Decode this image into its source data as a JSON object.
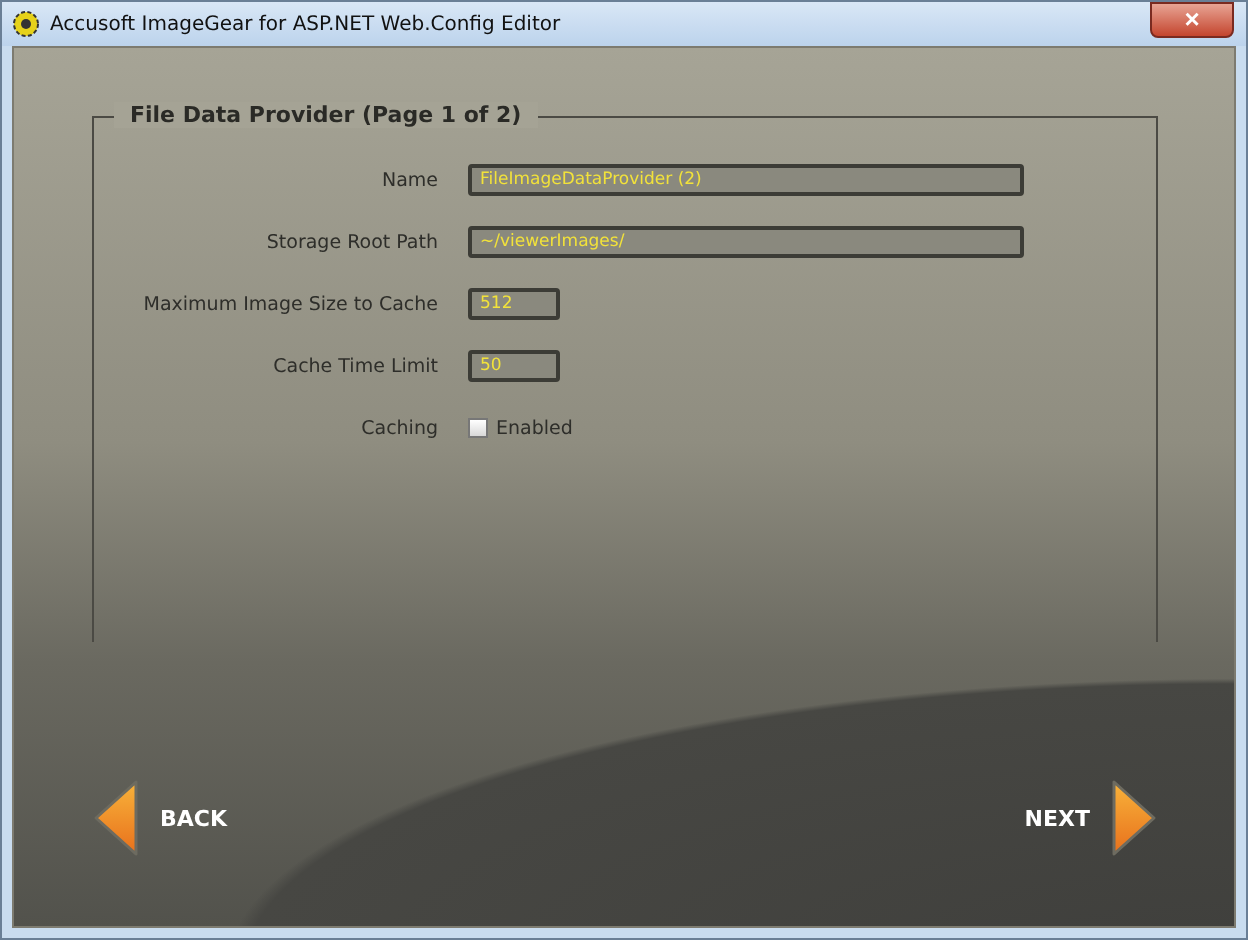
{
  "window": {
    "title": "Accusoft ImageGear for ASP.NET Web.Config Editor",
    "close": "×"
  },
  "section": {
    "title": "File Data Provider (Page 1 of 2)"
  },
  "fields": [
    {
      "kind": "wide",
      "label": "Name",
      "value": "FileImageDataProvider (2)"
    },
    {
      "kind": "wide",
      "label": "Storage Root Path",
      "value": "~/viewerImages/"
    },
    {
      "kind": "short",
      "label": "Maximum Image Size to Cache",
      "value": "512"
    },
    {
      "kind": "short",
      "label": "Cache Time Limit",
      "value": "50"
    },
    {
      "kind": "checkbox",
      "label": "Caching",
      "option": "Enabled",
      "checked": false
    }
  ],
  "nav": {
    "back": "BACK",
    "next": "NEXT"
  }
}
